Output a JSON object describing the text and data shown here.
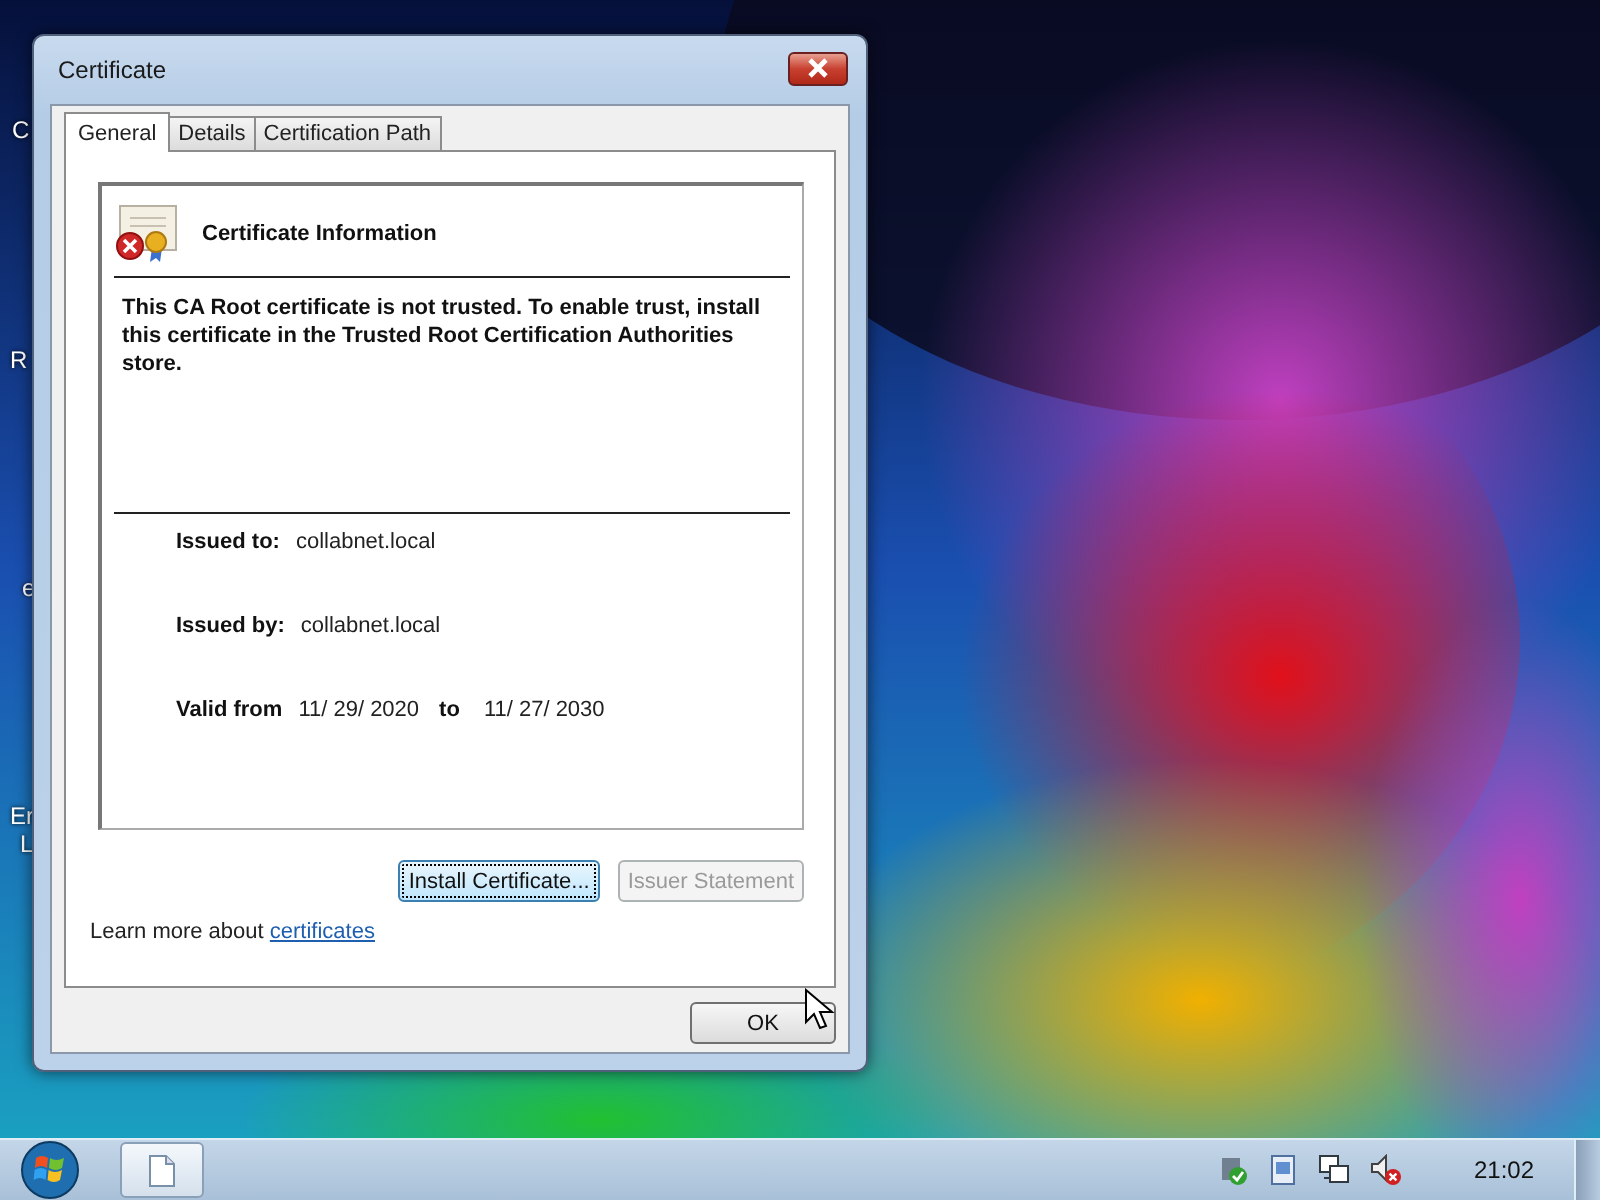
{
  "window": {
    "title": "Certificate"
  },
  "tabs": [
    {
      "label": "General",
      "selected": true
    },
    {
      "label": "Details",
      "selected": false
    },
    {
      "label": "Certification Path",
      "selected": false
    }
  ],
  "info": {
    "heading": "Certificate Information",
    "message": "This CA Root certificate is not trusted. To enable trust, install this certificate in the Trusted Root Certification Authorities store.",
    "fields": [
      {
        "label": "Issued to:",
        "value": "collabnet.local"
      },
      {
        "label": "Issued by:",
        "value": "collabnet.local"
      }
    ],
    "validity": {
      "label": "Valid from",
      "from": "11/ 29/ 2020",
      "to_label": "to",
      "to": "11/ 27/ 2030"
    }
  },
  "buttons": [
    {
      "label": "Install Certificate...",
      "disabled": false,
      "focused": true
    },
    {
      "label": "Issuer Statement",
      "disabled": true,
      "focused": false
    }
  ],
  "learn_more": {
    "text": "Learn more about",
    "link": "certificates"
  },
  "ok_button": {
    "label": "OK"
  },
  "taskbar": {
    "clock": "21:02"
  },
  "desktop_labels": [
    "C",
    "R",
    "e",
    "Er",
    "L"
  ]
}
